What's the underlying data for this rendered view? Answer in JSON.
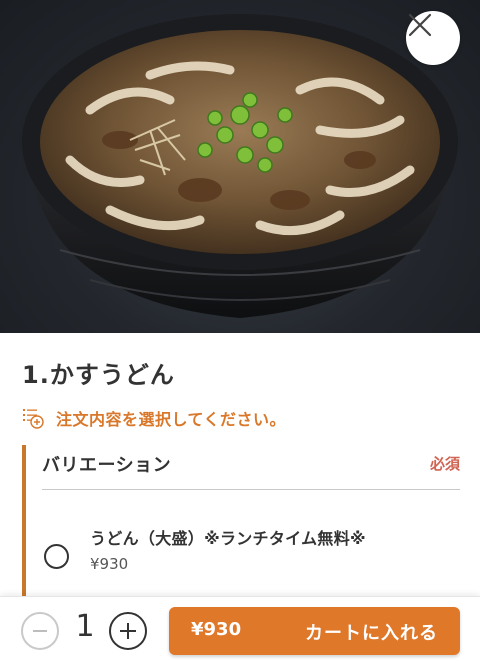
{
  "item": {
    "title": "1.かすうどん",
    "image_alt": "kasu udon bowl photo"
  },
  "prompt": {
    "icon": "list-add-icon",
    "text": "注文内容を選択してください。"
  },
  "variation": {
    "title": "バリエーション",
    "required_label": "必須",
    "options": [
      {
        "label": "うどん（大盛）※ランチタイム無料※",
        "price": "¥930",
        "selected": false
      }
    ]
  },
  "quantity": {
    "value": "1",
    "minus_icon": "minus-icon",
    "plus_icon": "plus-icon"
  },
  "cart": {
    "price": "¥930",
    "label": "カートに入れる"
  },
  "colors": {
    "accent": "#e0782a",
    "required": "#d06452",
    "variation_bar": "#c9772a"
  },
  "close_icon": "close-icon"
}
